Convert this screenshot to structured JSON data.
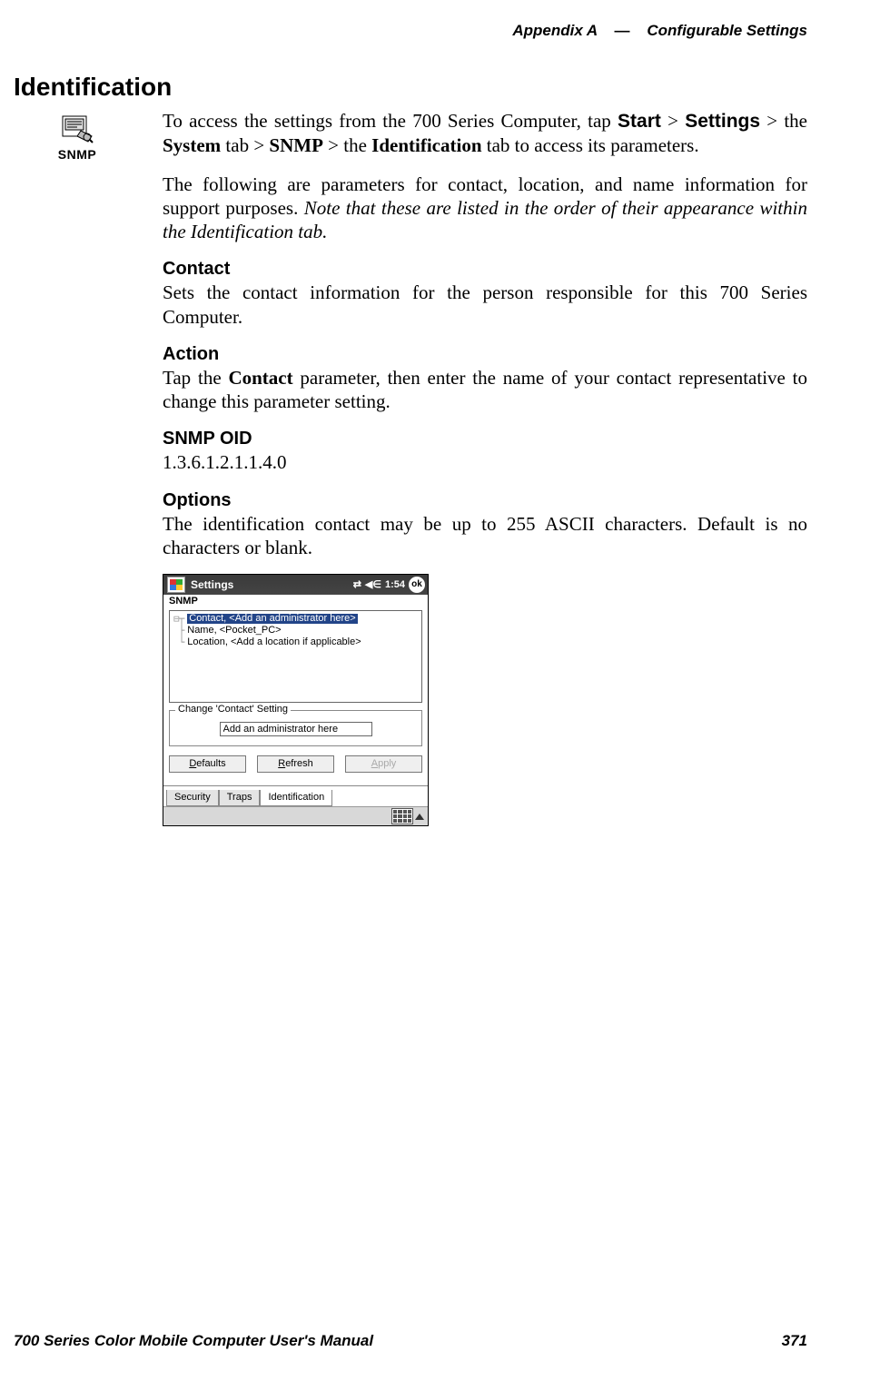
{
  "header": {
    "left": "Appendix A",
    "sep": "—",
    "right": "Configurable Settings"
  },
  "h1": "Identification",
  "icon_label": "SNMP",
  "intro": {
    "pre": "To access the settings from the 700 Series Computer, tap ",
    "start": "Start",
    "gt1": " > ",
    "settings": "Settings",
    "gt2": " > the ",
    "system": "System",
    "tab_text": " tab > ",
    "snmp": "SNMP",
    "gt3": " > the ",
    "identification": "Identification",
    "tail": " tab to access its parameters."
  },
  "para2": {
    "plain": "The following are parameters for contact, location, and name information for support purposes. ",
    "italic": "Note that these are listed in the order of their appearance within the Identification tab."
  },
  "sections": {
    "contact": {
      "heading": "Contact",
      "body": "Sets the contact information for the person responsible for this 700 Series Computer."
    },
    "action": {
      "heading": "Action",
      "body_pre": "Tap the ",
      "bold": "Contact",
      "body_post": " parameter, then enter the name of your contact representative to change this parameter setting."
    },
    "snmp_oid": {
      "heading": "SNMP OID",
      "body": "1.3.6.1.2.1.1.4.0"
    },
    "options": {
      "heading": "Options",
      "body": "The identification contact may be up to 255 ASCII characters. Default is no characters or blank."
    }
  },
  "device": {
    "title": "Settings",
    "clock": "1:54",
    "ok": "ok",
    "app_label": "SNMP",
    "tree": [
      {
        "label": "Contact, <Add an administrator here>",
        "selected": true
      },
      {
        "label": "Name, <Pocket_PC>",
        "selected": false
      },
      {
        "label": "Location, <Add a location if applicable>",
        "selected": false
      }
    ],
    "groupbox_legend": "Change 'Contact' Setting",
    "input_value": "Add an administrator here",
    "buttons": {
      "defaults_u": "D",
      "defaults_rest": "efaults",
      "refresh_u": "R",
      "refresh_rest": "efresh",
      "apply_u": "A",
      "apply_rest": "pply"
    },
    "tabs": {
      "security": "Security",
      "traps": "Traps",
      "identification": "Identification"
    }
  },
  "footer": {
    "left": "700 Series Color Mobile Computer User's Manual",
    "right": "371"
  }
}
